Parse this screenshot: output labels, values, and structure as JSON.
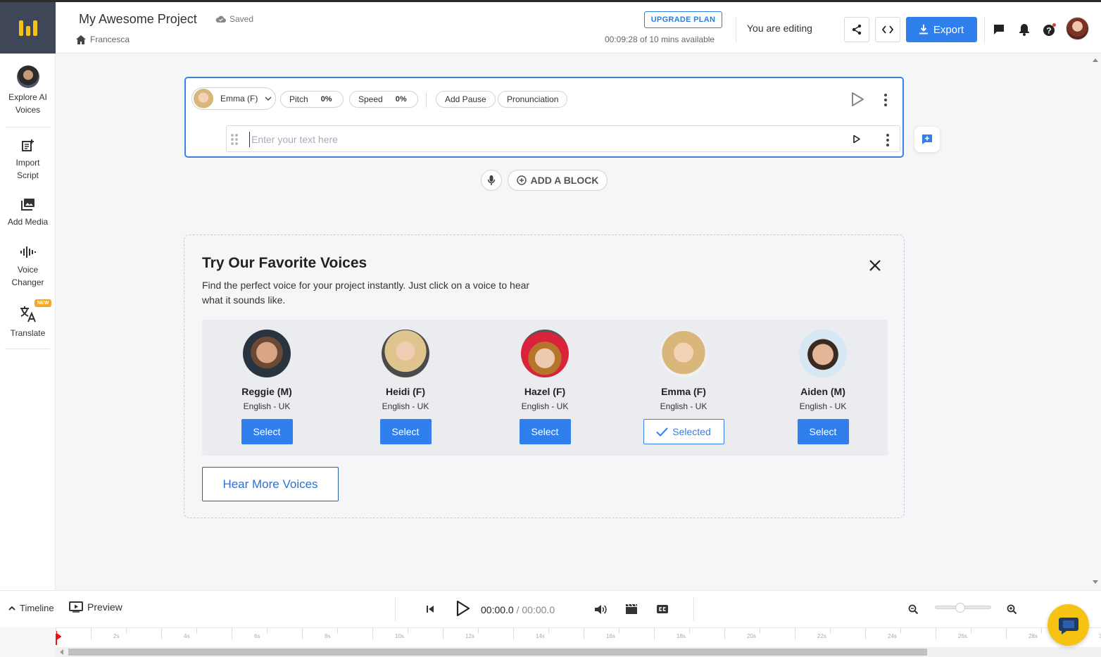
{
  "header": {
    "project_title": "My Awesome Project",
    "save_status": "Saved",
    "breadcrumb": "Francesca",
    "upgrade_label": "UPGRADE PLAN",
    "usage_text": "00:09:28 of 10 mins available",
    "editing_status": "You are editing",
    "export_label": "Export",
    "icons": [
      "share-icon",
      "code-icon",
      "download-icon",
      "comment-icon",
      "bell-icon",
      "help-icon"
    ],
    "accent_color": "#2f80ed",
    "brand_color": "#f6c315"
  },
  "sidebar": {
    "items": [
      {
        "label_1": "Explore AI",
        "label_2": "Voices",
        "icon": "ai-voice-avatar"
      },
      {
        "label_1": "Import",
        "label_2": "Script",
        "icon": "import-script-icon"
      },
      {
        "label_1": "Add Media",
        "label_2": "",
        "icon": "media-icon"
      },
      {
        "label_1": "Voice",
        "label_2": "Changer",
        "icon": "voice-changer-icon"
      },
      {
        "label_1": "Translate",
        "label_2": "",
        "icon": "translate-icon"
      }
    ],
    "new_badge": "NEW"
  },
  "editor": {
    "voice_name": "Emma (F)",
    "pitch_label": "Pitch",
    "pitch_value": "0%",
    "speed_label": "Speed",
    "speed_value": "0%",
    "add_pause_label": "Add Pause",
    "pronunciation_label": "Pronunciation",
    "text_placeholder": "Enter your text here",
    "add_block_label": "ADD A BLOCK"
  },
  "favorites": {
    "title": "Try Our Favorite Voices",
    "description": "Find the perfect voice for your project instantly. Just click on a voice to hear what it sounds like.",
    "voices": [
      {
        "name": "Reggie (M)",
        "lang": "English - UK",
        "button": "Select"
      },
      {
        "name": "Heidi (F)",
        "lang": "English - UK",
        "button": "Select"
      },
      {
        "name": "Hazel (F)",
        "lang": "English - UK",
        "button": "Select"
      },
      {
        "name": "Emma (F)",
        "lang": "English - UK",
        "button": "Selected"
      },
      {
        "name": "Aiden (M)",
        "lang": "English - UK",
        "button": "Select"
      }
    ],
    "hear_more_label": "Hear More Voices"
  },
  "player": {
    "timeline_label": "Timeline",
    "preview_label": "Preview",
    "current_time": "00:00.0",
    "separator": " / ",
    "total_time": "00:00.0",
    "ruler_ticks": [
      "2s",
      "4s",
      "6s",
      "8s",
      "10s",
      "12s",
      "14s",
      "16s",
      "18s",
      "20s",
      "22s",
      "24s",
      "26s",
      "28s",
      "3"
    ]
  }
}
